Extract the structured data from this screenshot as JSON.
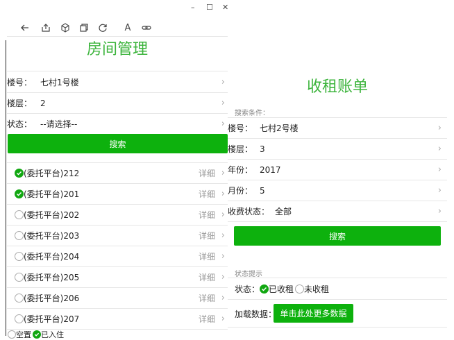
{
  "window": {
    "minimize": "–",
    "maximize": "☐",
    "close": "✕"
  },
  "toolbar": {
    "icons": [
      "back-arrow-icon",
      "share-icon",
      "cube-icon",
      "copy-icon",
      "refresh-icon",
      "font-icon",
      "link-icon"
    ],
    "font_glyph": "A"
  },
  "left": {
    "title": "房间管理",
    "fields": [
      {
        "label": "楼号：",
        "value": "七村1号楼"
      },
      {
        "label": "楼层：",
        "value": "2"
      },
      {
        "label": "状态：",
        "value": "--请选择--"
      }
    ],
    "search_label": "搜索",
    "rooms": [
      {
        "name": "(委托平台)212",
        "checked": true,
        "detail": "详细"
      },
      {
        "name": "(委托平台)201",
        "checked": true,
        "detail": "详细"
      },
      {
        "name": "(委托平台)202",
        "checked": false,
        "detail": "详细"
      },
      {
        "name": "(委托平台)203",
        "checked": false,
        "detail": "详细"
      },
      {
        "name": "(委托平台)204",
        "checked": false,
        "detail": "详细"
      },
      {
        "name": "(委托平台)205",
        "checked": false,
        "detail": "详细"
      },
      {
        "name": "(委托平台)206",
        "checked": false,
        "detail": "详细"
      },
      {
        "name": "(委托平台)207",
        "checked": false,
        "detail": "详细"
      }
    ],
    "legend": {
      "vacant": "空置",
      "occupied": "已入住"
    }
  },
  "right": {
    "title": "收租账单",
    "search_conditions": "搜索条件：",
    "fields": [
      {
        "label": "楼号：",
        "value": "七村2号楼"
      },
      {
        "label": "楼层：",
        "value": "3"
      },
      {
        "label": "年份：",
        "value": "2017"
      },
      {
        "label": "月份：",
        "value": "5"
      },
      {
        "label": "收费状态：",
        "value": "全部"
      }
    ],
    "search_label": "搜索",
    "status_hint": "状态提示",
    "status_label": "状态：",
    "rent_collected": "已收租",
    "rent_uncollected": "未收租",
    "load_label": "加载数据：",
    "load_more": "单击此处更多数据"
  },
  "colors": {
    "accent": "#0db10d",
    "title": "#3cb43c"
  }
}
